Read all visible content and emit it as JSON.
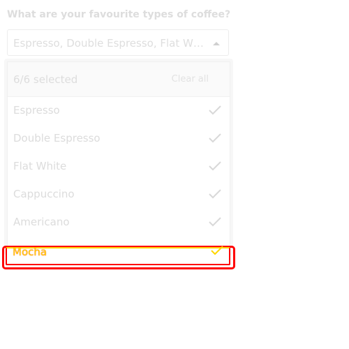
{
  "question": "What are your favourite types of coffee?",
  "select": {
    "value": "Espresso, Double Espresso, Flat White, Cappuccino, Americano, Mocha"
  },
  "dropdown": {
    "count_text": "6/6 selected",
    "clear_all": "Clear all",
    "options": [
      {
        "label": "Espresso",
        "checked": true
      },
      {
        "label": "Double Espresso",
        "checked": true
      },
      {
        "label": "Flat White",
        "checked": true
      },
      {
        "label": "Cappuccino",
        "checked": true
      },
      {
        "label": "Americano",
        "checked": true
      },
      {
        "label": "Mocha",
        "checked": true
      }
    ]
  },
  "colors": {
    "highlight": "#ff0000",
    "focus_text": "#ffd700"
  },
  "icons": {
    "caret": "caret-up-icon",
    "check": "check-icon"
  }
}
